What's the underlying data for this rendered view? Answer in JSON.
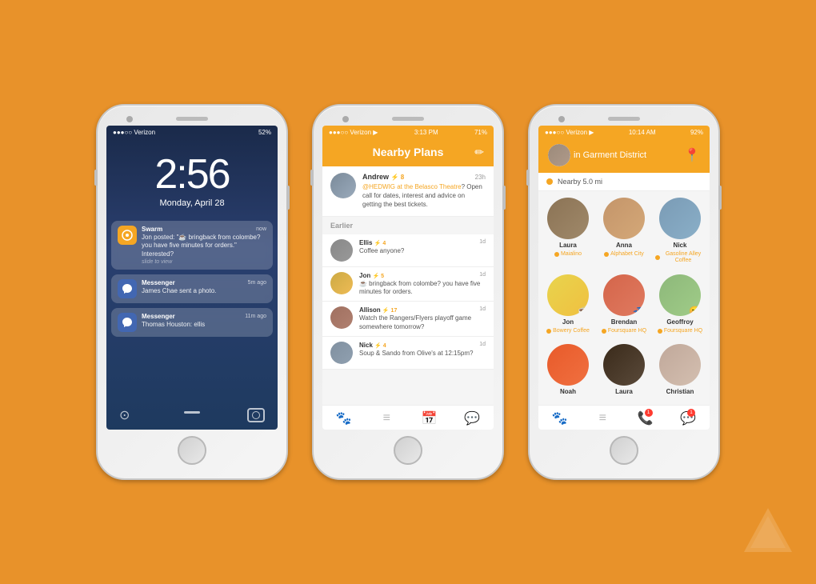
{
  "background": "#E8922A",
  "phone1": {
    "time": "2:56",
    "date": "Monday, April 28",
    "statusbar": {
      "left": "●●●○○ Verizon",
      "right": "52%"
    },
    "notifications": [
      {
        "app": "Swarm",
        "time": "now",
        "text": "Jon posted: \"☕ bringback from colombe? you have five minutes for orders.\" Interested?",
        "slide": "slide to view",
        "type": "swarm"
      },
      {
        "app": "Messenger",
        "time": "5m ago",
        "text": "James Chae sent a photo.",
        "type": "messenger"
      },
      {
        "app": "Messenger",
        "time": "11m ago",
        "text": "Thomas Houston: ellis",
        "type": "messenger"
      }
    ]
  },
  "phone2": {
    "statusbar": {
      "left": "●●●○○ Verizon",
      "time": "3:13 PM",
      "right": "71%"
    },
    "title": "Nearby Plans",
    "edit_icon": "✏",
    "main_post": {
      "name": "Andrew",
      "score": "⚡ 8",
      "time": "23h",
      "text": "@HEDWIG at the Belasco Theatre? Open call for dates, interest and advice on getting the best tickets."
    },
    "section_label": "Earlier",
    "earlier_posts": [
      {
        "name": "Ellis",
        "score": "⚡ 4",
        "time": "1d",
        "text": "Coffee anyone?"
      },
      {
        "name": "Jon",
        "score": "⚡ 5",
        "time": "1d",
        "text": "☕ bringback from colombe? you have five minutes for orders."
      },
      {
        "name": "Allison",
        "score": "⚡ 17",
        "time": "1d",
        "text": "Watch the Rangers/Flyers playoff game somewhere tomorrow?"
      },
      {
        "name": "Nick",
        "score": "⚡ 4",
        "time": "1d",
        "text": "Soup & Sando from Olive's at 12:15pm?"
      }
    ],
    "tabs": [
      "🐾",
      "≡",
      "📅",
      "💬"
    ]
  },
  "phone3": {
    "statusbar": {
      "left": "●●●○○ Verizon",
      "time": "10:14 AM",
      "right": "92%"
    },
    "location": "in Garment District",
    "nearby": "Nearby 5.0 mi",
    "people": [
      {
        "name": "Laura",
        "place": "Maialino",
        "avatar_class": "av-laura"
      },
      {
        "name": "Anna",
        "place": "Alphabet City",
        "avatar_class": "av-anna"
      },
      {
        "name": "Nick",
        "place": "Gasoline Alley Coffee",
        "avatar_class": "av-nick"
      },
      {
        "name": "Jon",
        "place": "Bowery Coffee",
        "avatar_class": "av-jon",
        "emoji": "☕"
      },
      {
        "name": "Brendan",
        "place": "Foursquare HQ",
        "avatar_class": "av-brendan",
        "emoji": "💤"
      },
      {
        "name": "Geoffroy",
        "place": "Foursquare HQ",
        "avatar_class": "av-geoffroy",
        "emoji": "😊"
      },
      {
        "name": "Noah",
        "place": "",
        "avatar_class": "av-noah"
      },
      {
        "name": "Laura",
        "place": "",
        "avatar_class": "av-laura2"
      },
      {
        "name": "Christian",
        "place": "",
        "avatar_class": "av-christian"
      }
    ]
  }
}
